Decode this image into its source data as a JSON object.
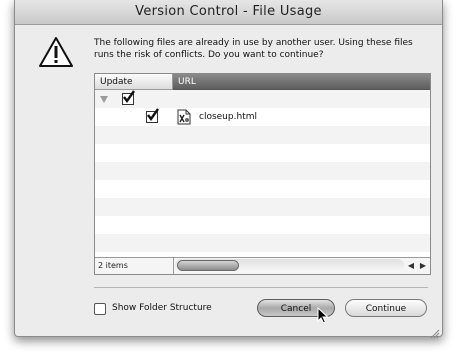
{
  "window": {
    "title": "Version Control - File Usage"
  },
  "icons": {
    "warning": "warning-triangle-icon",
    "file": "html-file-icon",
    "cursor": "mouse-pointer-icon"
  },
  "dialog": {
    "message": "The following files are already in use by another user. Using these files runs the risk of conflicts. Do you want to continue?"
  },
  "table": {
    "columns": [
      "Update",
      "URL"
    ],
    "rows": [
      {
        "type": "folder",
        "checked": true,
        "label": ""
      },
      {
        "type": "file",
        "checked": true,
        "label": "closeup.html"
      }
    ],
    "item_count": "2 items",
    "hscroll": {
      "left_arrow": "◀",
      "right_arrow": "▶"
    }
  },
  "footer": {
    "show_folder_structure_label": "Show Folder Structure",
    "show_folder_structure_checked": false,
    "cancel_label": "Cancel",
    "continue_label": "Continue"
  }
}
